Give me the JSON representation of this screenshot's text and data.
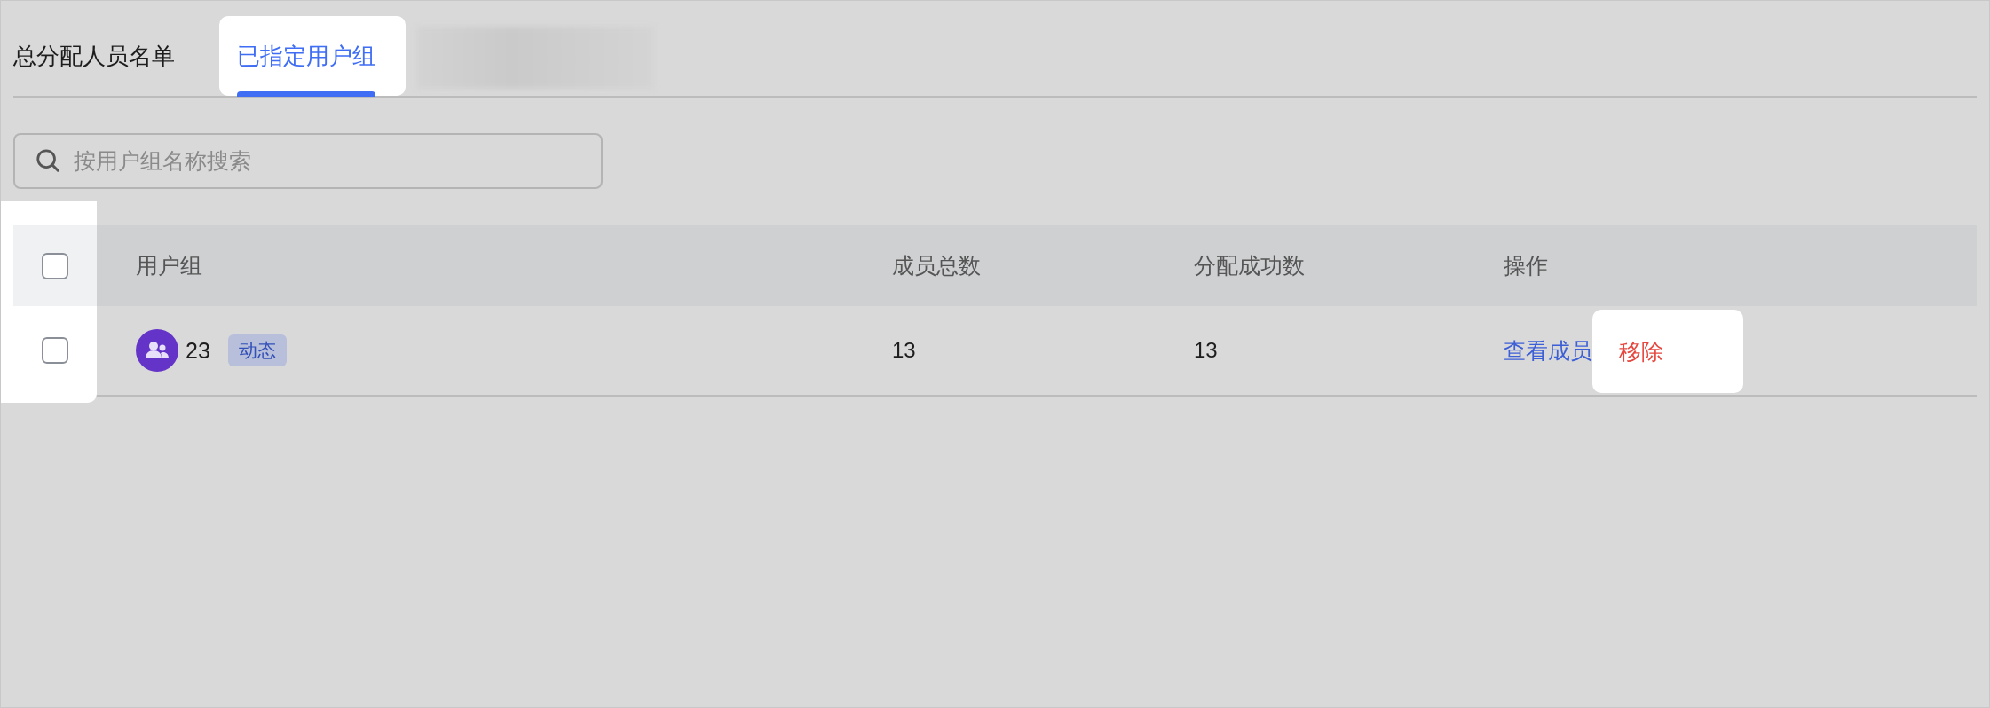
{
  "tabs": [
    {
      "kind": "text",
      "label": "总分配人员名单",
      "selected": false,
      "highlighted": false
    },
    {
      "kind": "text",
      "label": "已指定用户组",
      "selected": true,
      "highlighted": true
    },
    {
      "kind": "redacted"
    }
  ],
  "search": {
    "placeholder": "按用户组名称搜索"
  },
  "table": {
    "checkbox_column_highlighted": true,
    "header_checked": false,
    "columns": [
      "用户组",
      "成员总数",
      "分配成功数",
      "操作"
    ],
    "rows": [
      {
        "checked": false,
        "group": "23",
        "tag": "动态",
        "member_total": "13",
        "assigned_success": "13",
        "actions": [
          {
            "label": "查看成员",
            "kind": "link",
            "highlighted": false
          },
          {
            "label": "移除",
            "kind": "danger",
            "highlighted": true
          }
        ]
      }
    ]
  }
}
